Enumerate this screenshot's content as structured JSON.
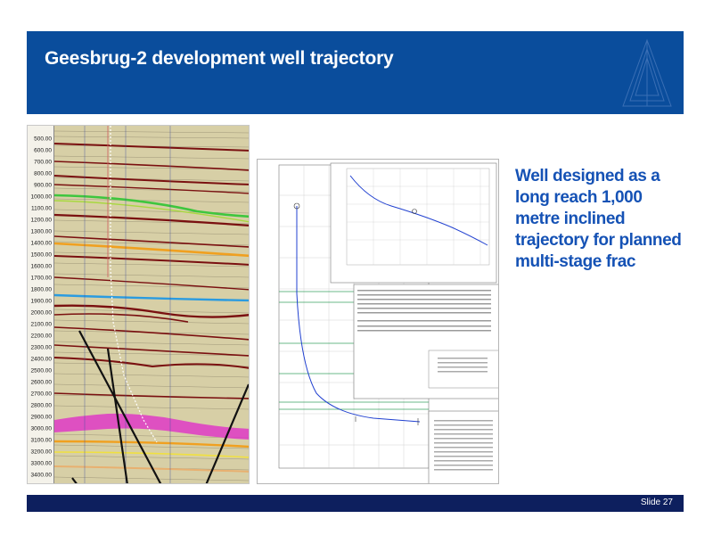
{
  "slide": {
    "title": "Geesbrug-2 development well trajectory",
    "bullet": "Well designed as a long reach 1,000 metre inclined trajectory for planned multi-stage frac",
    "footer_label": "Slide 27"
  },
  "seismic": {
    "depth_labels": [
      "500.00",
      "600.00",
      "700.00",
      "800.00",
      "900.00",
      "1000.00",
      "1100.00",
      "1200.00",
      "1300.00",
      "1400.00",
      "1500.00",
      "1600.00",
      "1700.00",
      "1800.00",
      "1900.00",
      "2000.00",
      "2100.00",
      "2200.00",
      "2300.00",
      "2400.00",
      "2500.00",
      "2600.00",
      "2700.00",
      "2800.00",
      "2900.00",
      "3000.00",
      "3100.00",
      "3200.00",
      "3300.00",
      "3400.00"
    ]
  },
  "colors": {
    "banner": "#0a4d9c",
    "footer": "#0d1f5e",
    "bullet_text": "#1552b5",
    "horizon_green": "#3ec63e",
    "horizon_orange": "#f0a020",
    "horizon_blue": "#2a9be0",
    "horizon_magenta": "#e030c8",
    "trajectory_blue": "#2040d0"
  },
  "icons": {
    "banner_logo": "triangle-logo-icon"
  }
}
